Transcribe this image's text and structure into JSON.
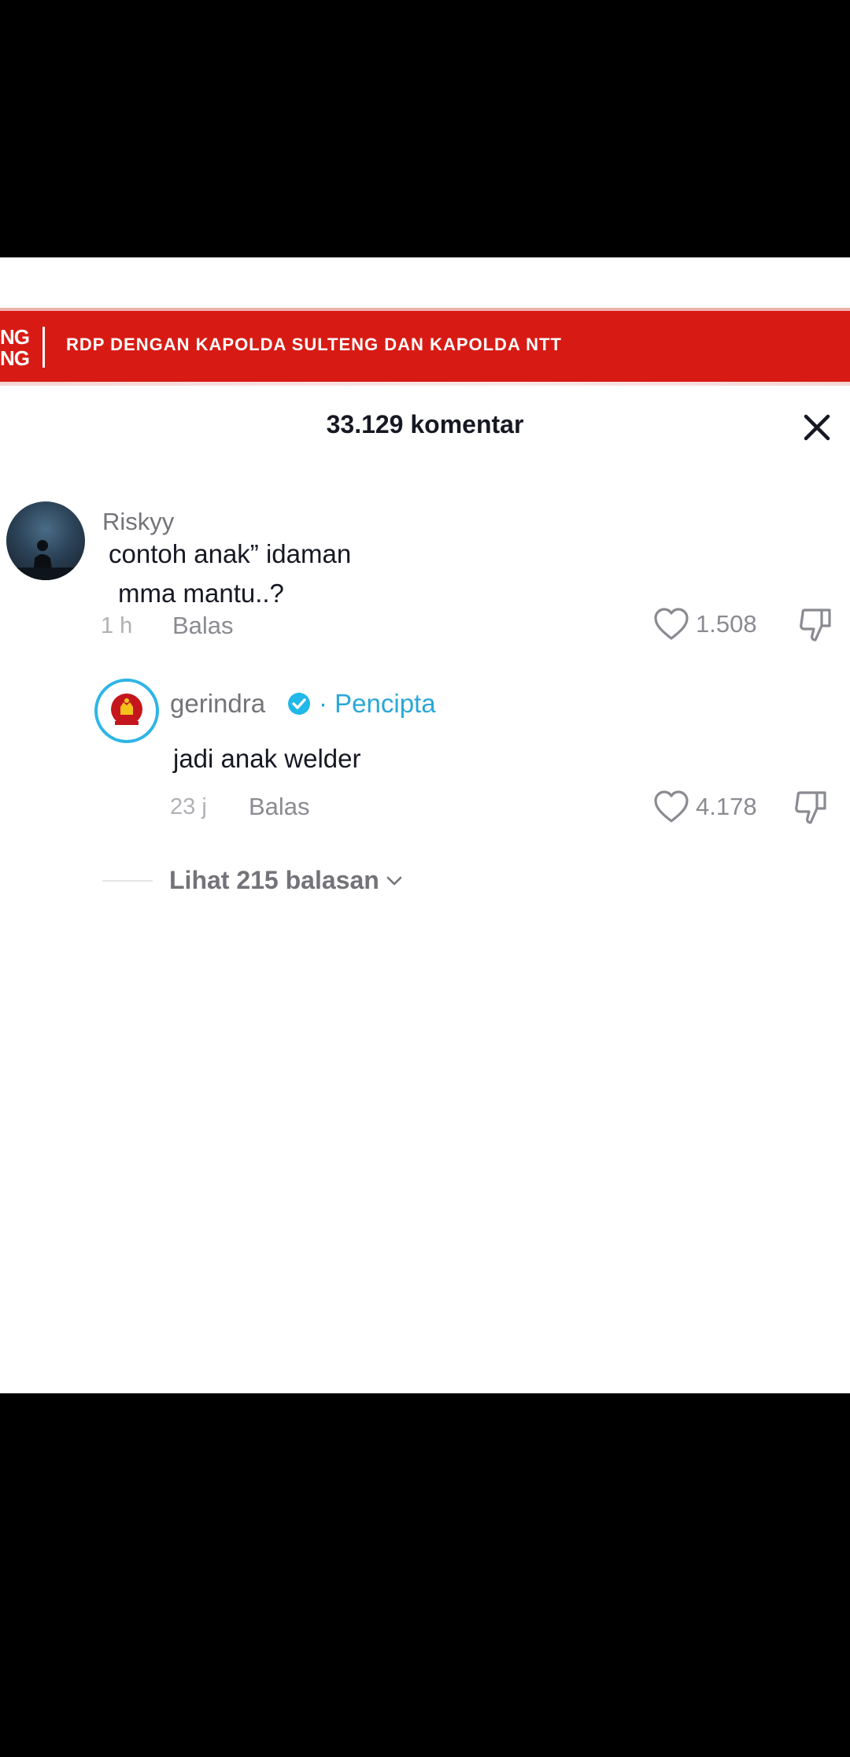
{
  "banner": {
    "left_label_lines": [
      "NG",
      "NG"
    ],
    "headline": "RDP DENGAN KAPOLDA SULTENG DAN KAPOLDA NTT"
  },
  "comments_header": {
    "title": "33.129 komentar",
    "close_icon": "close-icon"
  },
  "comments": [
    {
      "username": "Riskyy",
      "text_lines": [
        "contoh anak” idaman",
        "mma mantu..?"
      ],
      "time": "1 h",
      "reply_label": "Balas",
      "likes": "1.508"
    }
  ],
  "reply": {
    "username": "gerindra",
    "badge": "· Pencipta",
    "text": "jadi anak welder",
    "time": "23 j",
    "reply_label": "Balas",
    "likes": "4.178"
  },
  "view_replies": {
    "label": "Lihat 215 balasan"
  },
  "colors": {
    "banner_red": "#d71b14",
    "accent_blue": "#2aa7d8",
    "text_dark": "#161823",
    "text_gray": "#8a8b91"
  }
}
